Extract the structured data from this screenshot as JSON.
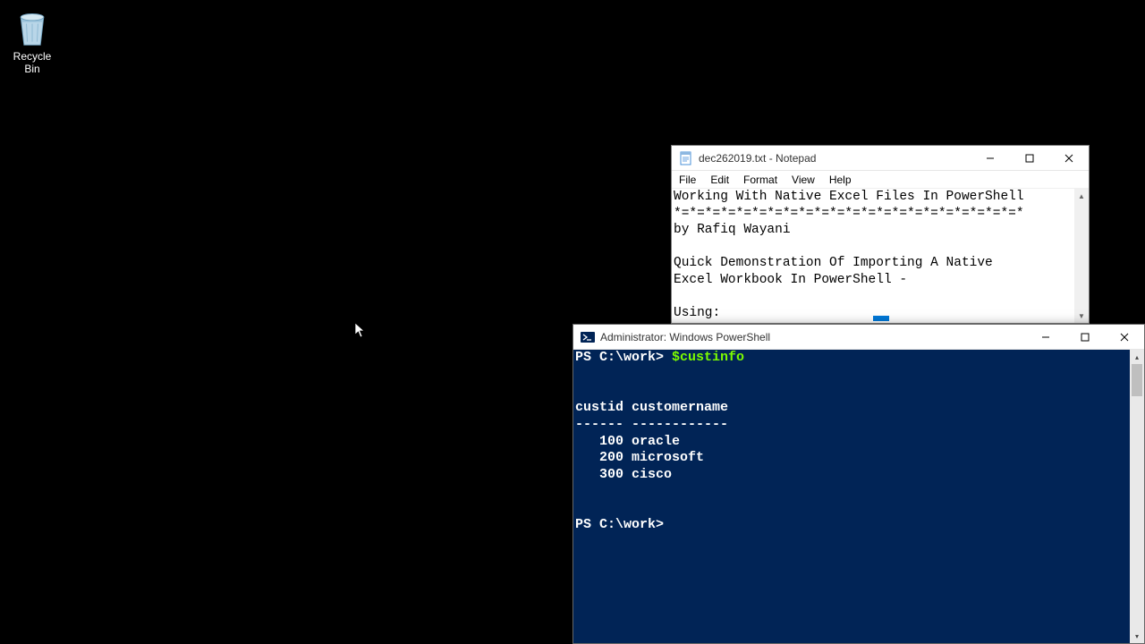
{
  "desktop": {
    "recycle_bin_label": "Recycle Bin"
  },
  "notepad": {
    "title": "dec262019.txt - Notepad",
    "menu": {
      "file": "File",
      "edit": "Edit",
      "format": "Format",
      "view": "View",
      "help": "Help"
    },
    "content": "Working With Native Excel Files In PowerShell\n*=*=*=*=*=*=*=*=*=*=*=*=*=*=*=*=*=*=*=*=*=*=*\nby Rafiq Wayani\n\nQuick Demonstration Of Importing A Native\nExcel Workbook In PowerShell -\n\nUsing:"
  },
  "powershell": {
    "title": "Administrator: Windows PowerShell",
    "prompt1": "PS C:\\work> ",
    "command1": "$custinfo",
    "output_header": "custid customername",
    "output_sep": "------ ------------",
    "rows": [
      {
        "id": "   100",
        "name": " oracle"
      },
      {
        "id": "   200",
        "name": " microsoft"
      },
      {
        "id": "   300",
        "name": " cisco"
      }
    ],
    "prompt2": "PS C:\\work>"
  }
}
